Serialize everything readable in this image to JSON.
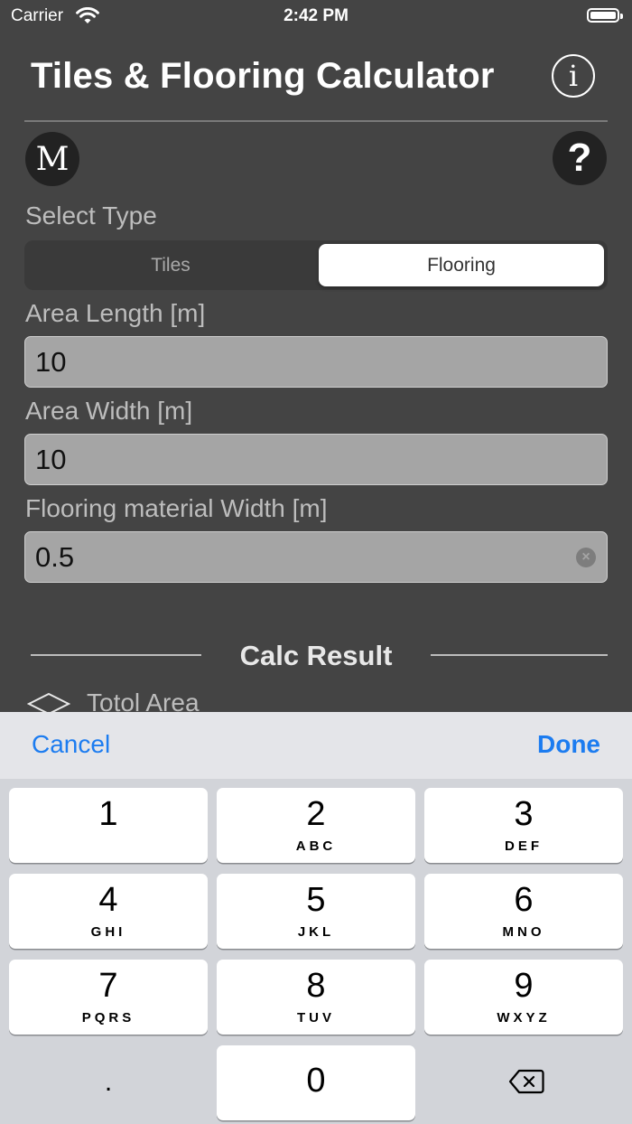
{
  "status_bar": {
    "carrier": "Carrier",
    "time": "2:42 PM"
  },
  "header": {
    "title": "Tiles & Flooring Calculator",
    "info_glyph": "i"
  },
  "toolbar_icons": {
    "m_glyph": "M",
    "help_glyph": "?"
  },
  "select_type": {
    "label": "Select Type",
    "options": [
      "Tiles",
      "Flooring"
    ],
    "selected": "Flooring"
  },
  "fields": {
    "length": {
      "label": "Area Length [m]",
      "value": "10"
    },
    "width": {
      "label": "Area Width [m]",
      "value": "10"
    },
    "material_width": {
      "label": "Flooring material Width [m]",
      "value": "0.5"
    }
  },
  "result": {
    "title": "Calc Result",
    "total_area_label": "Totol Area"
  },
  "keyboard_toolbar": {
    "cancel": "Cancel",
    "done": "Done"
  },
  "keypad": {
    "k1": {
      "digit": "1",
      "letters": ""
    },
    "k2": {
      "digit": "2",
      "letters": "ABC"
    },
    "k3": {
      "digit": "3",
      "letters": "DEF"
    },
    "k4": {
      "digit": "4",
      "letters": "GHI"
    },
    "k5": {
      "digit": "5",
      "letters": "JKL"
    },
    "k6": {
      "digit": "6",
      "letters": "MNO"
    },
    "k7": {
      "digit": "7",
      "letters": "PQRS"
    },
    "k8": {
      "digit": "8",
      "letters": "TUV"
    },
    "k9": {
      "digit": "9",
      "letters": "WXYZ"
    },
    "k0": {
      "digit": "0"
    },
    "decimal": "."
  },
  "colors": {
    "background": "#444444",
    "accent": "#1c7cf0",
    "field": "#a5a5a5"
  }
}
